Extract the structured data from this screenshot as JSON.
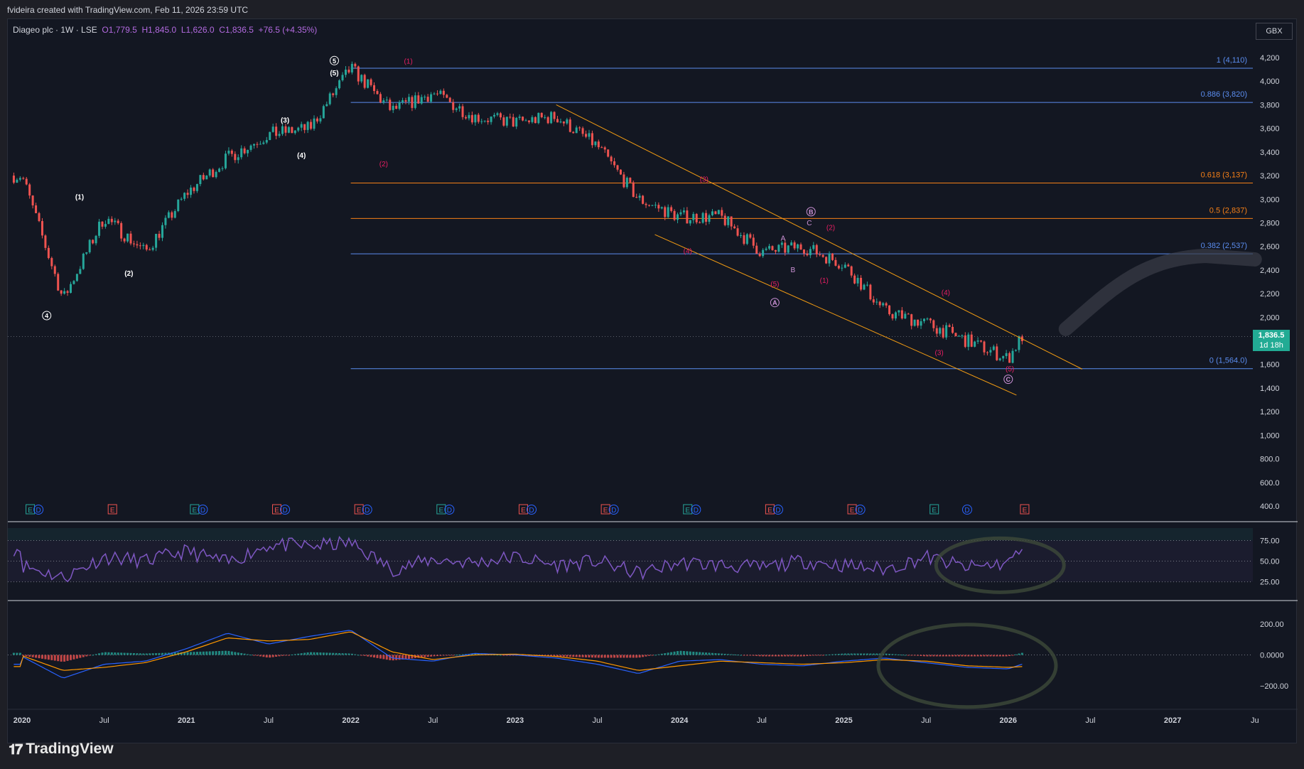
{
  "header": {
    "attribution": "fvideira created with TradingView.com, Feb 11, 2026 23:59 UTC"
  },
  "legend": {
    "symbol": "Diageo plc · 1W · LSE",
    "open": "O1,779.5",
    "high": "H1,845.0",
    "low": "L1,626.0",
    "close": "C1,836.5",
    "change": "+76.5 (+4.35%)"
  },
  "currency": "GBX",
  "last_price": {
    "value": "1,836.5",
    "countdown": "1d 18h"
  },
  "brand": {
    "logo_text": "TradingView"
  },
  "colors": {
    "background": "#131722",
    "up": "#26a69a",
    "down": "#ef5350",
    "fib_blue": "#2962ff",
    "fib_orange": "#f57f17",
    "channel": "#f39c12",
    "wave_pink": "#e91e63",
    "rsi": "#7e57c2",
    "macd": "#2962ff",
    "signal": "#ff9800"
  },
  "chart_data": [
    {
      "type": "line",
      "subtype": "candlestick-weekly",
      "title": "",
      "y_ticks": [
        "4,200",
        "4,000",
        "3,800",
        "3,600",
        "3,400",
        "3,200",
        "3,000",
        "2,800",
        "2,600",
        "2,400",
        "2,200",
        "2,000",
        "1,800",
        "1,600",
        "1,400",
        "1,200",
        "1,000",
        "800.0",
        "600.0",
        "400.0"
      ],
      "ylim": [
        400,
        4200
      ],
      "x_ticks": [
        "2020",
        "Jul",
        "2021",
        "Jul",
        "2022",
        "Jul",
        "2023",
        "Jul",
        "2024",
        "Jul",
        "2025",
        "Jul",
        "2026",
        "Jul",
        "2027",
        "Ju"
      ],
      "x": [
        "2020-01",
        "2020-04",
        "2020-07",
        "2020-10",
        "2021-01",
        "2021-04",
        "2021-07",
        "2021-10",
        "2022-01",
        "2022-04",
        "2022-07",
        "2022-10",
        "2023-01",
        "2023-04",
        "2023-07",
        "2023-10",
        "2024-01",
        "2024-04",
        "2024-07",
        "2024-10",
        "2025-01",
        "2025-04",
        "2025-07",
        "2025-10",
        "2026-01",
        "2026-02"
      ],
      "series": [
        {
          "values": [
            3200,
            2150,
            2850,
            2550,
            3050,
            3350,
            3550,
            3600,
            4110,
            3750,
            3900,
            3700,
            3650,
            3700,
            3450,
            3000,
            2850,
            2850,
            2550,
            2600,
            2450,
            2050,
            1950,
            1800,
            1650,
            1836.5
          ]
        }
      ],
      "fib_levels": [
        {
          "label": "1 (4,110)",
          "value": 4110,
          "color": "#5b8def"
        },
        {
          "label": "0.886 (3,820)",
          "value": 3820,
          "color": "#5b8def"
        },
        {
          "label": "0.618 (3,137)",
          "value": 3137,
          "color": "#f57f17"
        },
        {
          "label": "0.5 (2,837)",
          "value": 2837,
          "color": "#f57f17"
        },
        {
          "label": "0.382 (2,537)",
          "value": 2537,
          "color": "#5b8def"
        },
        {
          "label": "0 (1,564.0)",
          "value": 1564,
          "color": "#5b8def"
        }
      ],
      "wave_labels": {
        "black": [
          "(1)",
          "(2)",
          "(3)",
          "(4)",
          "(5)"
        ],
        "circled": [
          "4",
          "5",
          "A",
          "B",
          "C"
        ],
        "pink": [
          "(1)",
          "(2)",
          "(3)",
          "(4)",
          "(5)",
          "(1)",
          "(2)",
          "(3)",
          "(4)",
          "(5)",
          "(3)",
          "(4)",
          "(5)"
        ],
        "abc": [
          "A",
          "B",
          "C"
        ]
      },
      "event_markers": [
        "E",
        "D",
        "E",
        "E",
        "D",
        "E",
        "D",
        "E",
        "D",
        "E",
        "D",
        "E",
        "D",
        "E",
        "D",
        "E",
        "D",
        "E",
        "D",
        "E",
        "D",
        "E",
        "D",
        "E"
      ]
    },
    {
      "type": "line",
      "subtype": "rsi",
      "title": "",
      "y_ticks": [
        "75.00",
        "50.00",
        "25.00"
      ],
      "ylim": [
        10,
        90
      ],
      "series": [
        {
          "values": [
            45,
            30,
            55,
            50,
            62,
            48,
            70,
            68,
            72,
            40,
            52,
            48,
            55,
            45,
            50,
            35,
            48,
            45,
            42,
            50,
            45,
            40,
            55,
            42,
            48,
            65
          ]
        }
      ]
    },
    {
      "type": "bar",
      "subtype": "macd",
      "title": "",
      "y_ticks": [
        "200.00",
        "0.0000",
        "−200.00"
      ],
      "ylim": [
        -300,
        300
      ],
      "series": [
        {
          "values": [
            -10,
            -150,
            -60,
            -40,
            40,
            140,
            70,
            120,
            160,
            -20,
            -40,
            10,
            0,
            -20,
            -60,
            -120,
            -40,
            -30,
            -60,
            -70,
            -40,
            -20,
            -50,
            -80,
            -90,
            -60
          ]
        },
        {
          "values": [
            -5,
            -100,
            -80,
            -50,
            20,
            110,
            90,
            100,
            150,
            20,
            -30,
            0,
            5,
            -10,
            -40,
            -100,
            -70,
            -40,
            -50,
            -60,
            -50,
            -30,
            -40,
            -70,
            -80,
            -75
          ]
        }
      ]
    }
  ]
}
